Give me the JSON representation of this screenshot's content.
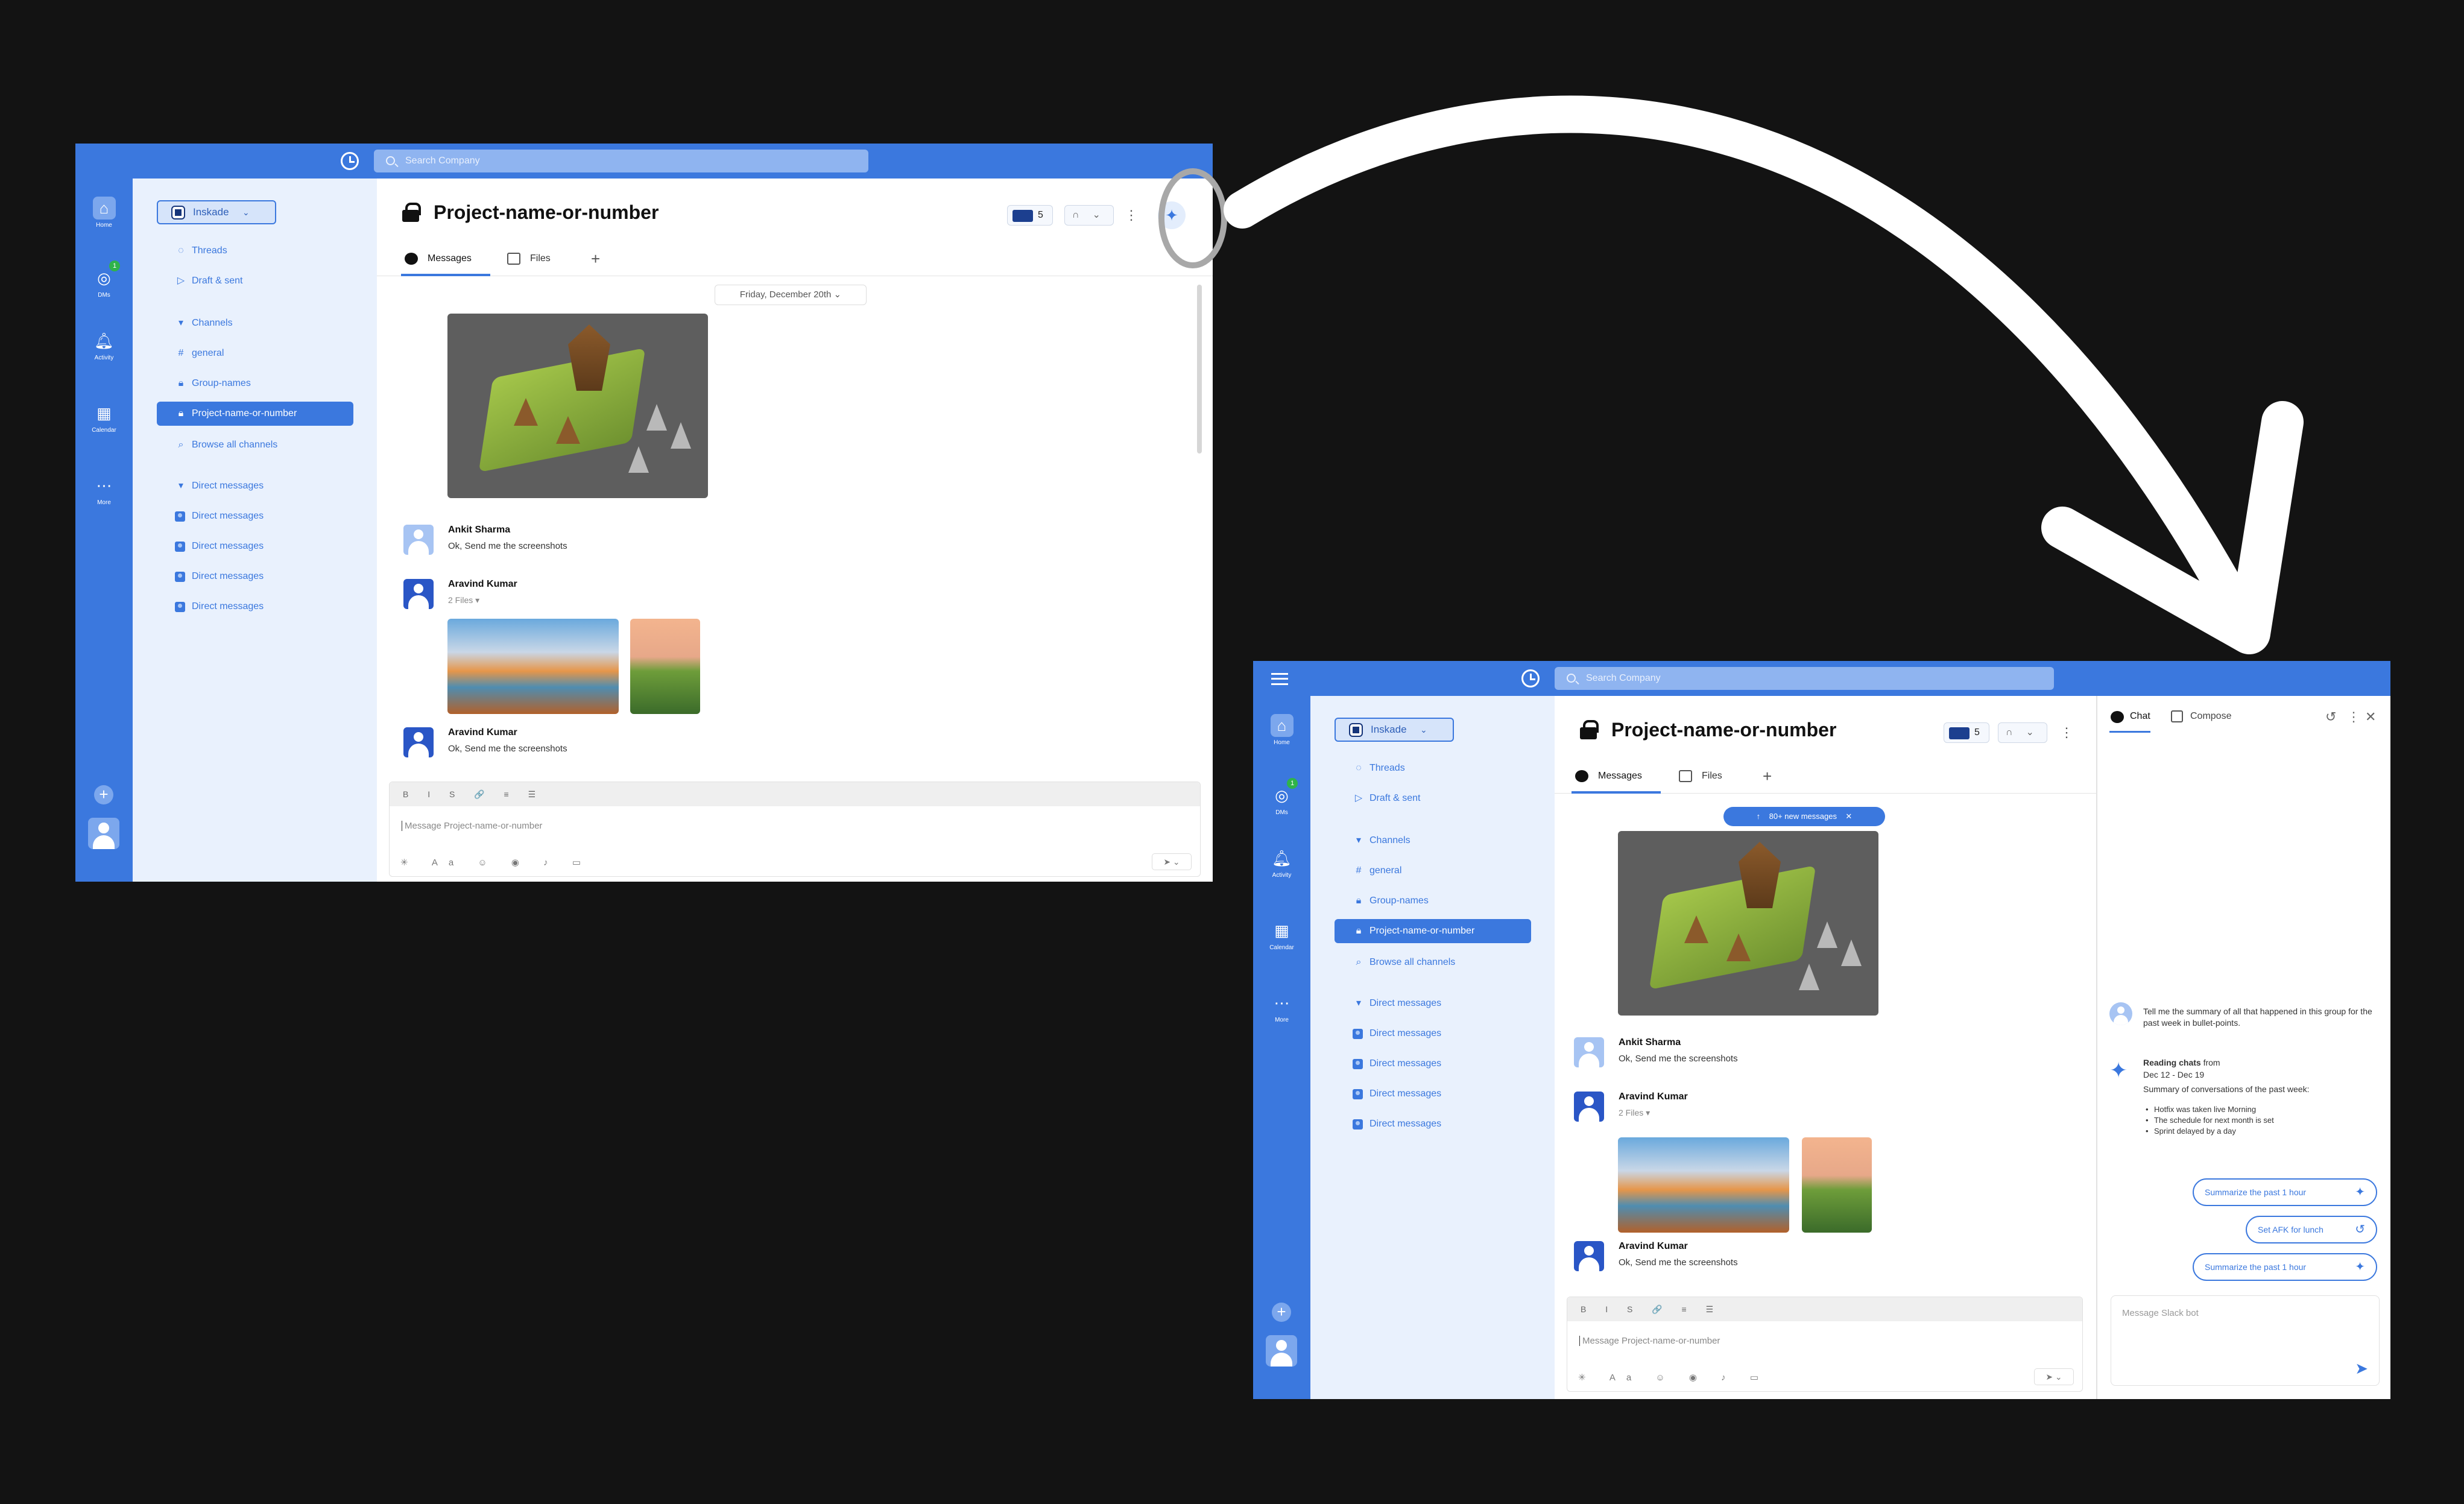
{
  "common": {
    "search_placeholder": "Search Company",
    "workspace": "Inskade",
    "rail": [
      "Home",
      "DMs",
      "Activity",
      "Calendar",
      "More"
    ],
    "dm_badge": "1",
    "sidebar": {
      "threads": "Threads",
      "drafts": "Draft & sent",
      "channels_header": "Channels",
      "channels": [
        "general",
        "Group-names",
        "Project-name-or-number"
      ],
      "browse": "Browse all channels",
      "dm_header": "Direct messages",
      "dms": [
        "Direct messages",
        "Direct messages",
        "Direct messages",
        "Direct messages"
      ]
    },
    "channel_title": "Project-name-or-number",
    "member_count": "5",
    "tabs": {
      "messages": "Messages",
      "files": "Files"
    },
    "messages": [
      {
        "name": "Ankit Sharma",
        "text": "Ok, Send me the screenshots"
      },
      {
        "name": "Aravind Kumar",
        "files": "2 Files"
      },
      {
        "name": "Aravind Kumar",
        "text": "Ok, Send me the screenshots"
      }
    ],
    "composer_placeholder": "Message Project-name-or-number",
    "fmt": "B I S 🔗 ≡ ☰"
  },
  "before": {
    "date_label": "Friday, December 20th"
  },
  "after": {
    "new_messages": "80+ new messages",
    "ai_panel": {
      "tab_chat": "Chat",
      "tab_compose": "Compose",
      "user_question": "Tell me the summary of all that happened in this group for the past week in bullet-points.",
      "reading_bold": "Reading chats",
      "reading_rest": " from",
      "range": "Dec 12 - Dec 19",
      "summary_intro": "Summary of conversations of the past week:",
      "bullets": [
        "Hotfix was taken live Morning",
        "The schedule for next month is set",
        "Sprint delayed by a day"
      ],
      "chips": [
        "Summarize the past 1 hour",
        "Set AFK for lunch",
        "Summarize the past 1 hour"
      ],
      "input_placeholder": "Message Slack bot"
    }
  },
  "colors": {
    "accent": "#3b78de",
    "sidebar_bg": "#e9f1fd",
    "canvas": "#131313"
  }
}
